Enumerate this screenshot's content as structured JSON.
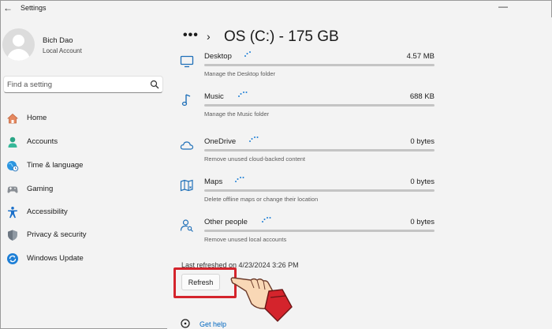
{
  "window": {
    "title": "Settings"
  },
  "user": {
    "name": "Bich Dao",
    "account_type": "Local Account"
  },
  "search": {
    "placeholder": "Find a setting"
  },
  "nav": {
    "items": [
      {
        "label": "Home",
        "icon": "home-icon",
        "color": "#c0623a"
      },
      {
        "label": "Accounts",
        "icon": "person-icon",
        "color": "#2aa586"
      },
      {
        "label": "Time & language",
        "icon": "globe-clock-icon",
        "color": "#1e8ad6"
      },
      {
        "label": "Gaming",
        "icon": "gamepad-icon",
        "color": "#707070"
      },
      {
        "label": "Accessibility",
        "icon": "accessibility-icon",
        "color": "#1a6fc9"
      },
      {
        "label": "Privacy & security",
        "icon": "shield-icon",
        "color": "#7f8a96"
      },
      {
        "label": "Windows Update",
        "icon": "sync-icon",
        "color": "#1e7fd6"
      }
    ]
  },
  "breadcrumb": {
    "more": "•••",
    "separator": "›"
  },
  "page": {
    "title": "OS (C:) - 175 GB"
  },
  "storage": {
    "rows": [
      {
        "label": "Desktop",
        "size": "4.57 MB",
        "desc": "Manage the Desktop folder",
        "icon": "monitor-icon"
      },
      {
        "label": "Music",
        "size": "688 KB",
        "desc": "Manage the Music folder",
        "icon": "music-note-icon"
      },
      {
        "label": "OneDrive",
        "size": "0 bytes",
        "desc": "Remove unused cloud-backed content",
        "icon": "cloud-icon"
      },
      {
        "label": "Maps",
        "size": "0 bytes",
        "desc": "Delete offline maps or change their location",
        "icon": "map-icon"
      },
      {
        "label": "Other people",
        "size": "0 bytes",
        "desc": "Remove unused local accounts",
        "icon": "person-search-icon"
      }
    ],
    "last_refreshed": "Last refreshed on 4/23/2024 3:26 PM",
    "refresh_label": "Refresh"
  },
  "help": {
    "label": "Get help",
    "icon": "help-icon"
  },
  "colors": {
    "accent": "#0067c0",
    "highlight": "#d4242c",
    "pointer_cuff": "#d4242c",
    "pointer_skin": "#f9d8b6"
  }
}
